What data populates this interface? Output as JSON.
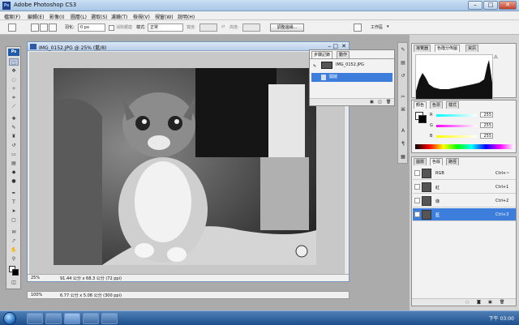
{
  "app": {
    "title": "Adobe Photoshop CS3",
    "window_controls": {
      "minimize": "–",
      "maximize": "□",
      "close": "✕"
    }
  },
  "menu": [
    "檔案(F)",
    "編輯(E)",
    "影像(I)",
    "圖層(L)",
    "選取(S)",
    "濾鏡(T)",
    "檢視(V)",
    "視窗(W)",
    "說明(H)"
  ],
  "options_bar": {
    "feather_label": "羽化:",
    "feather_value": "0 px",
    "antialias_label": "消除鋸齒",
    "style_label": "樣式:",
    "style_value": "正常",
    "width_label": "寬度:",
    "height_label": "高度:",
    "refine_edge_button": "調整邊緣...",
    "workspace_label": "工作區"
  },
  "document": {
    "title": "IMG_0152.JPG @ 25% (藍/8)",
    "zoom": "25%",
    "doc_size": "91.44 公分 x 68.3 公分 (72 ppi)",
    "secondary_zoom": "100%",
    "secondary_doc_size": "6.77 公分 x 5.08 公分 (300 ppi)"
  },
  "history_panel": {
    "tabs": [
      "步驟記錄",
      "動作"
    ],
    "snapshot": "IMG_0152.JPG",
    "steps": [
      "開啟"
    ]
  },
  "navigator_panel": {
    "tabs": [
      "導覽器",
      "色階分佈圖",
      "資訊"
    ]
  },
  "color_panel": {
    "tabs": [
      "顏色",
      "色票",
      "樣式"
    ],
    "channels": [
      {
        "label": "R",
        "value": "255",
        "color": "#e04040"
      },
      {
        "label": "G",
        "value": "255",
        "color": "#40c040"
      },
      {
        "label": "B",
        "value": "255",
        "color": "#4060e0"
      }
    ]
  },
  "channels_panel": {
    "tabs": [
      "圖層",
      "色版",
      "路徑"
    ],
    "rows": [
      {
        "name": "RGB",
        "shortcut": "Ctrl+~"
      },
      {
        "name": "紅",
        "shortcut": "Ctrl+1"
      },
      {
        "name": "綠",
        "shortcut": "Ctrl+2"
      },
      {
        "name": "藍",
        "shortcut": "Ctrl+3"
      }
    ],
    "selected_index": 3
  },
  "taskbar": {
    "clock": "下午 03:00"
  },
  "icons": {
    "tools": [
      "marquee-icon",
      "move-icon",
      "lasso-icon",
      "magic-wand-icon",
      "crop-icon",
      "slice-icon",
      "healing-icon",
      "brush-icon",
      "stamp-icon",
      "history-brush-icon",
      "eraser-icon",
      "gradient-icon",
      "blur-icon",
      "dodge-icon",
      "pen-icon",
      "type-icon",
      "path-select-icon",
      "shape-icon",
      "notes-icon",
      "eyedropper-icon",
      "hand-icon",
      "zoom-icon"
    ]
  }
}
